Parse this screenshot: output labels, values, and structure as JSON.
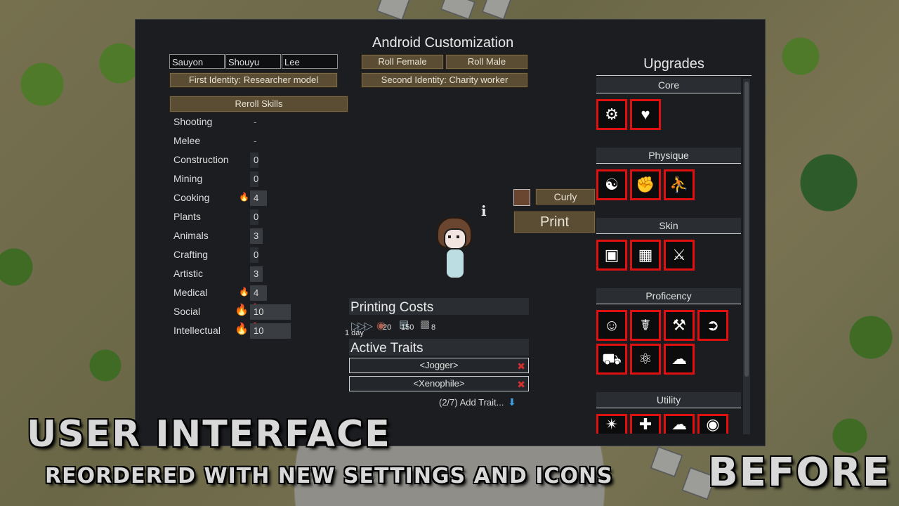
{
  "header": {
    "title": "Android Customization"
  },
  "names": {
    "first": "Sauyon",
    "nick": "Shouyu",
    "last": "Lee"
  },
  "buttons": {
    "roll_female": "Roll Female",
    "roll_male": "Roll Male",
    "first_identity": "First Identity: Researcher model",
    "second_identity": "Second Identity: Charity worker",
    "reroll_skills": "Reroll Skills",
    "hair_style": "Curly",
    "print": "Print"
  },
  "skills": [
    {
      "name": "Shooting",
      "level": "-",
      "passion": ""
    },
    {
      "name": "Melee",
      "level": "-",
      "passion": ""
    },
    {
      "name": "Construction",
      "level": "0",
      "passion": ""
    },
    {
      "name": "Mining",
      "level": "0",
      "passion": ""
    },
    {
      "name": "Cooking",
      "level": "4",
      "passion": "minor"
    },
    {
      "name": "Plants",
      "level": "0",
      "passion": ""
    },
    {
      "name": "Animals",
      "level": "3",
      "passion": ""
    },
    {
      "name": "Crafting",
      "level": "0",
      "passion": ""
    },
    {
      "name": "Artistic",
      "level": "3",
      "passion": ""
    },
    {
      "name": "Medical",
      "level": "4",
      "passion": "minor"
    },
    {
      "name": "Social",
      "level": "10",
      "passion": "major"
    },
    {
      "name": "Intellectual",
      "level": "10",
      "passion": "major"
    }
  ],
  "printing_costs": {
    "title": "Printing Costs",
    "time": "1 day",
    "items": [
      {
        "icon": "meat-icon",
        "amount": "20"
      },
      {
        "icon": "plasteel-icon",
        "amount": "150"
      },
      {
        "icon": "component-icon",
        "amount": "8"
      }
    ]
  },
  "active_traits": {
    "title": "Active Traits",
    "items": [
      "<Jogger>",
      "<Xenophile>"
    ],
    "add_label": "(2/7) Add Trait..."
  },
  "upgrades": {
    "title": "Upgrades",
    "sections": [
      {
        "name": "Core",
        "icons": [
          "robot-icon",
          "broken-heart-icon"
        ]
      },
      {
        "name": "Physique",
        "icons": [
          "meditation-icon",
          "muscle-arm-icon",
          "gymnast-icon"
        ]
      },
      {
        "name": "Skin",
        "icons": [
          "armor-vest-icon",
          "chest-plate-icon",
          "dragon-head-icon"
        ]
      },
      {
        "name": "Proficency",
        "icons": [
          "cheering-icon",
          "stethoscope-icon",
          "crane-icon",
          "conveyor-icon",
          "tractor-icon",
          "atom-icon",
          "handshake-icon"
        ]
      },
      {
        "name": "Utility",
        "icons": [
          "spiky-explosion-icon",
          "medkit-icon",
          "cloud-icon",
          "signal-icon"
        ]
      }
    ]
  },
  "overlay": {
    "line1": "USER INTERFACE",
    "line2": "REORDERED WITH NEW SETTINGS AND ICONS",
    "badge": "BEFORE"
  },
  "colors": {
    "accent_button": "#5b4d33",
    "upgrade_border": "#e01010",
    "passion": "#f0a020"
  }
}
